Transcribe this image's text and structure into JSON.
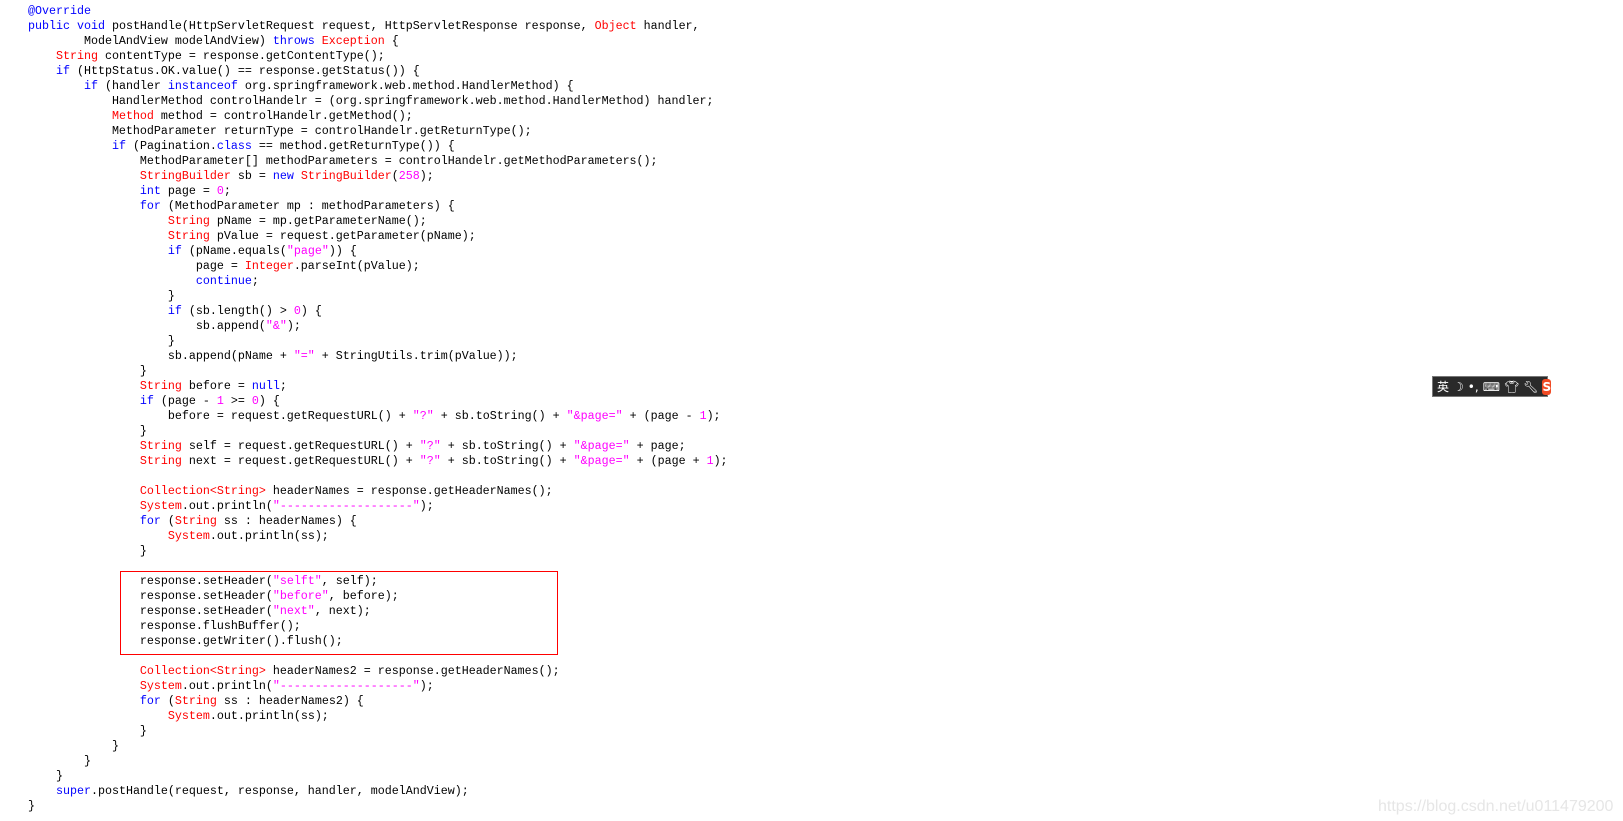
{
  "code_lines": [
    [
      [
        "a",
        "@Override"
      ]
    ],
    [
      [
        "k",
        "public void "
      ],
      [
        "p",
        "postHandle(HttpServletRequest request, HttpServletResponse response, "
      ],
      [
        "t",
        "Object"
      ],
      [
        "p",
        " handler,"
      ]
    ],
    [
      [
        "p",
        "        ModelAndView modelAndView) "
      ],
      [
        "k",
        "throws "
      ],
      [
        "t",
        "Exception"
      ],
      [
        "p",
        " {"
      ]
    ],
    [
      [
        "p",
        "    "
      ],
      [
        "t",
        "String"
      ],
      [
        "p",
        " contentType = response.getContentType();"
      ]
    ],
    [
      [
        "p",
        "    "
      ],
      [
        "k",
        "if"
      ],
      [
        "p",
        " (HttpStatus.OK.value() == response.getStatus()) {"
      ]
    ],
    [
      [
        "p",
        "        "
      ],
      [
        "k",
        "if"
      ],
      [
        "p",
        " (handler "
      ],
      [
        "k",
        "instanceof"
      ],
      [
        "p",
        " org.springframework.web.method.HandlerMethod) {"
      ]
    ],
    [
      [
        "p",
        "            HandlerMethod controlHandelr = (org.springframework.web.method.HandlerMethod) handler;"
      ]
    ],
    [
      [
        "p",
        "            "
      ],
      [
        "t",
        "Method"
      ],
      [
        "p",
        " method = controlHandelr.getMethod();"
      ]
    ],
    [
      [
        "p",
        "            MethodParameter returnType = controlHandelr.getReturnType();"
      ]
    ],
    [
      [
        "p",
        "            "
      ],
      [
        "k",
        "if"
      ],
      [
        "p",
        " (Pagination."
      ],
      [
        "k",
        "class"
      ],
      [
        "p",
        " == method.getReturnType()) {"
      ]
    ],
    [
      [
        "p",
        "                MethodParameter[] methodParameters = controlHandelr.getMethodParameters();"
      ]
    ],
    [
      [
        "p",
        "                "
      ],
      [
        "t",
        "StringBuilder"
      ],
      [
        "p",
        " sb = "
      ],
      [
        "k",
        "new "
      ],
      [
        "t",
        "StringBuilder"
      ],
      [
        "p",
        "("
      ],
      [
        "n",
        "258"
      ],
      [
        "p",
        ");"
      ]
    ],
    [
      [
        "p",
        "                "
      ],
      [
        "k",
        "int"
      ],
      [
        "p",
        " page = "
      ],
      [
        "n",
        "0"
      ],
      [
        "p",
        ";"
      ]
    ],
    [
      [
        "p",
        "                "
      ],
      [
        "k",
        "for"
      ],
      [
        "p",
        " (MethodParameter mp : methodParameters) {"
      ]
    ],
    [
      [
        "p",
        "                    "
      ],
      [
        "t",
        "String"
      ],
      [
        "p",
        " pName = mp.getParameterName();"
      ]
    ],
    [
      [
        "p",
        "                    "
      ],
      [
        "t",
        "String"
      ],
      [
        "p",
        " pValue = request.getParameter(pName);"
      ]
    ],
    [
      [
        "p",
        "                    "
      ],
      [
        "k",
        "if"
      ],
      [
        "p",
        " (pName.equals("
      ],
      [
        "s",
        "\"page\""
      ],
      [
        "p",
        ")) {"
      ]
    ],
    [
      [
        "p",
        "                        page = "
      ],
      [
        "t",
        "Integer"
      ],
      [
        "p",
        ".parseInt(pValue);"
      ]
    ],
    [
      [
        "p",
        "                        "
      ],
      [
        "k",
        "continue"
      ],
      [
        "p",
        ";"
      ]
    ],
    [
      [
        "p",
        "                    }"
      ]
    ],
    [
      [
        "p",
        "                    "
      ],
      [
        "k",
        "if"
      ],
      [
        "p",
        " (sb.length() > "
      ],
      [
        "n",
        "0"
      ],
      [
        "p",
        ") {"
      ]
    ],
    [
      [
        "p",
        "                        sb.append("
      ],
      [
        "s",
        "\"&\""
      ],
      [
        "p",
        ");"
      ]
    ],
    [
      [
        "p",
        "                    }"
      ]
    ],
    [
      [
        "p",
        "                    sb.append(pName + "
      ],
      [
        "s",
        "\"=\""
      ],
      [
        "p",
        " + StringUtils.trim(pValue));"
      ]
    ],
    [
      [
        "p",
        "                }"
      ]
    ],
    [
      [
        "p",
        "                "
      ],
      [
        "t",
        "String"
      ],
      [
        "p",
        " before = "
      ],
      [
        "k",
        "null"
      ],
      [
        "p",
        ";"
      ]
    ],
    [
      [
        "p",
        "                "
      ],
      [
        "k",
        "if"
      ],
      [
        "p",
        " (page - "
      ],
      [
        "n",
        "1"
      ],
      [
        "p",
        " >= "
      ],
      [
        "n",
        "0"
      ],
      [
        "p",
        ") {"
      ]
    ],
    [
      [
        "p",
        "                    before = request.getRequestURL() + "
      ],
      [
        "s",
        "\"?\""
      ],
      [
        "p",
        " + sb.toString() + "
      ],
      [
        "s",
        "\"&page=\""
      ],
      [
        "p",
        " + (page - "
      ],
      [
        "n",
        "1"
      ],
      [
        "p",
        ");"
      ]
    ],
    [
      [
        "p",
        "                }"
      ]
    ],
    [
      [
        "p",
        "                "
      ],
      [
        "t",
        "String"
      ],
      [
        "p",
        " self = request.getRequestURL() + "
      ],
      [
        "s",
        "\"?\""
      ],
      [
        "p",
        " + sb.toString() + "
      ],
      [
        "s",
        "\"&page=\""
      ],
      [
        "p",
        " + page;"
      ]
    ],
    [
      [
        "p",
        "                "
      ],
      [
        "t",
        "String"
      ],
      [
        "p",
        " next = request.getRequestURL() + "
      ],
      [
        "s",
        "\"?\""
      ],
      [
        "p",
        " + sb.toString() + "
      ],
      [
        "s",
        "\"&page=\""
      ],
      [
        "p",
        " + (page + "
      ],
      [
        "n",
        "1"
      ],
      [
        "p",
        ");"
      ]
    ],
    [],
    [
      [
        "p",
        "                "
      ],
      [
        "t",
        "Collection<String>"
      ],
      [
        "p",
        " headerNames = response.getHeaderNames();"
      ]
    ],
    [
      [
        "p",
        "                "
      ],
      [
        "t",
        "System"
      ],
      [
        "p",
        ".out.println("
      ],
      [
        "s",
        "\"-------------------\""
      ],
      [
        "p",
        ");"
      ]
    ],
    [
      [
        "p",
        "                "
      ],
      [
        "k",
        "for"
      ],
      [
        "p",
        " ("
      ],
      [
        "t",
        "String"
      ],
      [
        "p",
        " ss : headerNames) {"
      ]
    ],
    [
      [
        "p",
        "                    "
      ],
      [
        "t",
        "System"
      ],
      [
        "p",
        ".out.println(ss);"
      ]
    ],
    [
      [
        "p",
        "                }"
      ]
    ],
    [],
    [
      [
        "p",
        "                response.setHeader("
      ],
      [
        "s",
        "\"selft\""
      ],
      [
        "p",
        ", self);"
      ]
    ],
    [
      [
        "p",
        "                response.setHeader("
      ],
      [
        "s",
        "\"before\""
      ],
      [
        "p",
        ", before);"
      ]
    ],
    [
      [
        "p",
        "                response.setHeader("
      ],
      [
        "s",
        "\"next\""
      ],
      [
        "p",
        ", next);"
      ]
    ],
    [
      [
        "p",
        "                response.flushBuffer();"
      ]
    ],
    [
      [
        "p",
        "                response.getWriter().flush();"
      ]
    ],
    [],
    [
      [
        "p",
        "                "
      ],
      [
        "t",
        "Collection<String>"
      ],
      [
        "p",
        " headerNames2 = response.getHeaderNames();"
      ]
    ],
    [
      [
        "p",
        "                "
      ],
      [
        "t",
        "System"
      ],
      [
        "p",
        ".out.println("
      ],
      [
        "s",
        "\"-------------------\""
      ],
      [
        "p",
        ");"
      ]
    ],
    [
      [
        "p",
        "                "
      ],
      [
        "k",
        "for"
      ],
      [
        "p",
        " ("
      ],
      [
        "t",
        "String"
      ],
      [
        "p",
        " ss : headerNames2) {"
      ]
    ],
    [
      [
        "p",
        "                    "
      ],
      [
        "t",
        "System"
      ],
      [
        "p",
        ".out.println(ss);"
      ]
    ],
    [
      [
        "p",
        "                }"
      ]
    ],
    [
      [
        "p",
        "            }"
      ]
    ],
    [
      [
        "p",
        "        }"
      ]
    ],
    [
      [
        "p",
        "    }"
      ]
    ],
    [
      [
        "p",
        "    "
      ],
      [
        "k",
        "super"
      ],
      [
        "p",
        ".postHandle(request, response, handler, modelAndView);"
      ]
    ],
    [
      [
        "p",
        "}"
      ]
    ]
  ],
  "colors": {
    "keyword": "#0000ff",
    "type": "#ff0000",
    "string": "#ff00ff",
    "highlight_box": "#ff0000"
  },
  "ime_toolbar": {
    "lang_label": "英",
    "icons": [
      "moon-icon",
      "punctuation-icon",
      "keyboard-icon",
      "skin-shirt-icon",
      "wrench-icon",
      "sogou-logo-icon"
    ],
    "logo_letter": "S"
  },
  "watermark": "https://blog.csdn.net/u011479200"
}
